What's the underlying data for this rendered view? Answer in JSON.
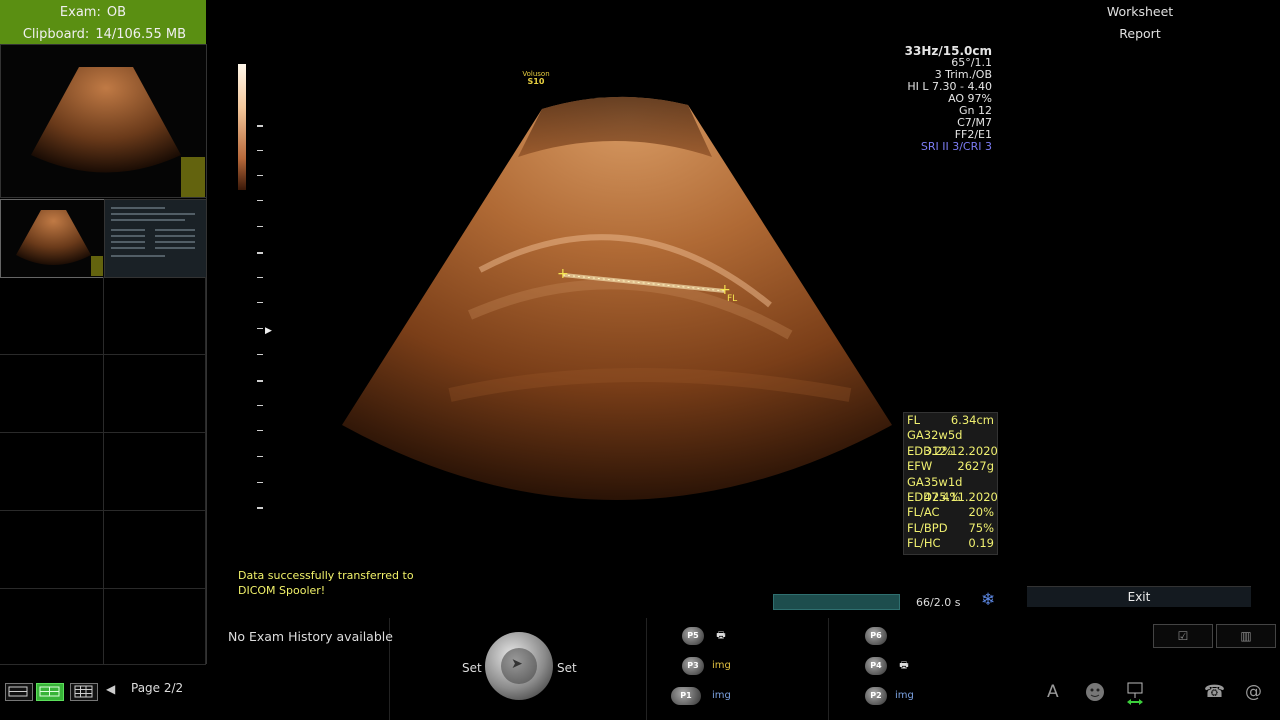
{
  "left_panel": {
    "exam_label": "Exam:",
    "exam_value": "OB",
    "clipboard_label": "Clipboard:",
    "clipboard_value": "14/106.55 MB",
    "page_indicator": "Page 2/2"
  },
  "ultrasound": {
    "logo_line1": "Voluson",
    "logo_line2": "S10",
    "params": [
      "33Hz/15.0cm",
      "65°/1.1",
      "3 Trim./OB",
      "HI L  7.30 - 4.40",
      "AO 97%",
      "Gn  12",
      "C7/M7",
      "FF2/E1",
      "SRI II 3/CRI 3"
    ],
    "caliper_label": "FL",
    "measurements": [
      {
        "label": "FL",
        "value": "6.34cm"
      },
      {
        "label": "GA",
        "value": "32w5d 3.2%"
      },
      {
        "label": "EDD",
        "value": "12.12.2020"
      },
      {
        "label": "EFW",
        "value": "2627g"
      },
      {
        "label": "GA",
        "value": "35w1d 47.4%"
      },
      {
        "label": "EDD",
        "value": "25.11.2020"
      },
      {
        "label": "FL/AC",
        "value": "20%"
      },
      {
        "label": "FL/BPD",
        "value": "75%"
      },
      {
        "label": "FL/HC",
        "value": "0.19"
      }
    ],
    "status_line1": "Data successfully transferred to",
    "status_line2": "DICOM Spooler!",
    "cine_text": "66/2.0 s"
  },
  "right_panel": {
    "worksheet": "Worksheet",
    "report": "Report",
    "exit": "Exit"
  },
  "bottom": {
    "exam_history": "No Exam History available",
    "set_left": "Set",
    "set_right": "Set",
    "p5": "P5",
    "p3": "P3",
    "p1": "P1",
    "p6": "P6",
    "p4": "P4",
    "p2": "P2",
    "img": "img",
    "text_icon": "A",
    "at_icon": "@"
  },
  "colors": {
    "exam_header_bg": "#5a8f12",
    "measurement_text": "#f0f070",
    "status_text": "#f2f26a",
    "sri_text": "#7d7df5",
    "active_layout": "#38b338"
  }
}
